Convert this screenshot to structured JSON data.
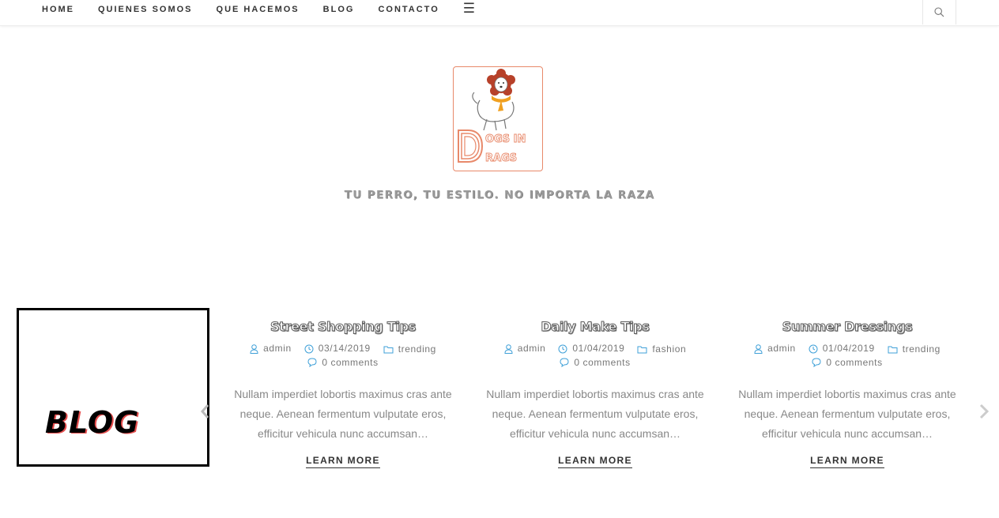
{
  "nav": {
    "items": [
      "HOME",
      "QUIENES SOMOS",
      "QUE HACEMOS",
      "BLOG",
      "CONTACTO"
    ],
    "menu_icon": "hamburger-icon",
    "search_icon": "search-icon"
  },
  "logo": {
    "line1": "OGS IN",
    "line2": "RAGS",
    "accent_color": "#e8896a"
  },
  "tagline": "TU PERRO, TU ESTILO. NO IMPORTA LA RAZA",
  "blog_box": {
    "label": "BLOG"
  },
  "posts": [
    {
      "title": "Street Shopping Tips",
      "author": "admin",
      "date": "03/14/2019",
      "category": "trending",
      "comments": "0 comments",
      "excerpt": "Nullam imperdiet lobortis maximus cras ante neque. Aenean fermentum vulputate eros, efficitur vehicula nunc accumsan…",
      "cta": "LEARN MORE"
    },
    {
      "title": "Daily Make Tips",
      "author": "admin",
      "date": "01/04/2019",
      "category": "fashion",
      "comments": "0 comments",
      "excerpt": "Nullam imperdiet lobortis maximus cras ante neque. Aenean fermentum vulputate eros, efficitur vehicula nunc accumsan…",
      "cta": "LEARN MORE"
    },
    {
      "title": "Summer Dressings",
      "author": "admin",
      "date": "01/04/2019",
      "category": "trending",
      "comments": "0 comments",
      "excerpt": "Nullam imperdiet lobortis maximus cras ante neque. Aenean fermentum vulputate eros, efficitur vehicula nunc accumsan…",
      "cta": "LEARN MORE"
    }
  ],
  "colors": {
    "meta_icon": "#3fa0d8",
    "text": "#888888"
  }
}
